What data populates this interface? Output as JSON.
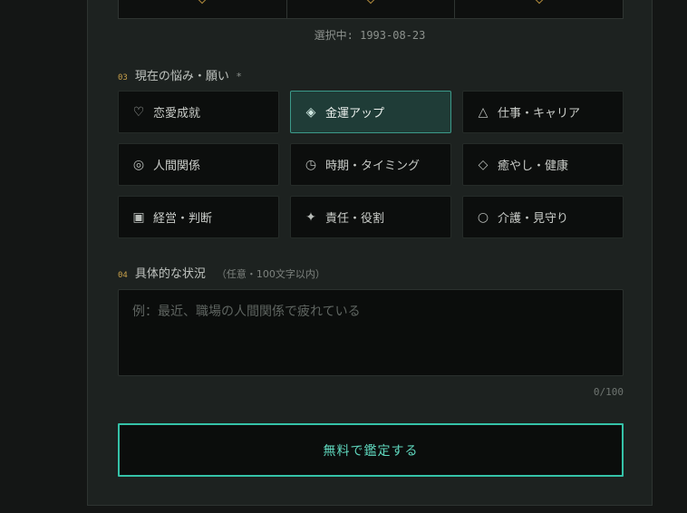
{
  "birthdate": {
    "selected_text": "選択中: 1993-08-23"
  },
  "concern": {
    "num": "03",
    "label": "現在の悩み・願い",
    "required_mark": "*",
    "options": [
      {
        "icon": "heart-icon",
        "glyph": "♡",
        "label": "恋愛成就",
        "selected": false
      },
      {
        "icon": "diamond-dot-icon",
        "glyph": "◈",
        "label": "金運アップ",
        "selected": true
      },
      {
        "icon": "triangle-icon",
        "glyph": "△",
        "label": "仕事・キャリア",
        "selected": false
      },
      {
        "icon": "double-circle-icon",
        "glyph": "◎",
        "label": "人間関係",
        "selected": false
      },
      {
        "icon": "clock-icon",
        "glyph": "◷",
        "label": "時期・タイミング",
        "selected": false
      },
      {
        "icon": "diamond-outline-icon",
        "glyph": "◇",
        "label": "癒やし・健康",
        "selected": false
      },
      {
        "icon": "square-dot-icon",
        "glyph": "▣",
        "label": "経営・判断",
        "selected": false
      },
      {
        "icon": "sparkle-icon",
        "glyph": "✦",
        "label": "責任・役割",
        "selected": false
      },
      {
        "icon": "circle-icon",
        "glyph": "○",
        "label": "介護・見守り",
        "selected": false
      }
    ]
  },
  "situation": {
    "num": "04",
    "label": "具体的な状況",
    "hint": "（任意・100文字以内）",
    "placeholder": "例：最近、職場の人間関係で疲れている",
    "value": "",
    "counter": "0/100"
  },
  "submit_label": "無料で鑑定する",
  "colors": {
    "accent": "#35c2a8",
    "gold": "#c8a04a",
    "selected_bg": "#1f3c37"
  }
}
